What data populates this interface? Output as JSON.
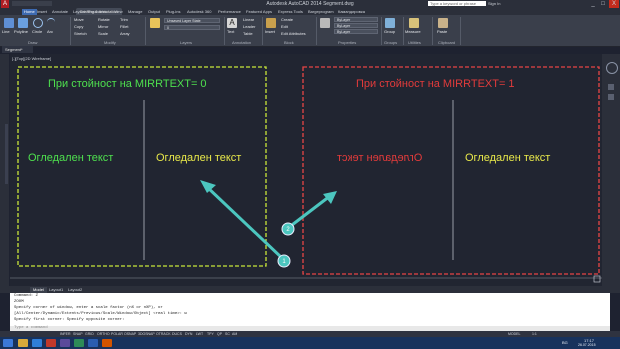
{
  "window": {
    "title": "Autodesk AutoCAD 2014  Segment.dwg",
    "search_placeholder": "Type a keyword or phrase",
    "signin": "Sign In",
    "minimize": "_",
    "maximize": "□",
    "close": "X"
  },
  "ribbon_tabs": {
    "file": "Drafting & Annotation",
    "items": [
      "Home",
      "Insert",
      "Annotate",
      "Layout",
      "Parametric",
      "View",
      "Manage",
      "Output",
      "Plug-ins",
      "Autodesk 360",
      "Performance",
      "Featured Apps",
      "Express Tools",
      "Bargeprogram",
      "Камандировка"
    ]
  },
  "ribbon": {
    "draw": {
      "line": "Line",
      "polyline": "Polyline",
      "circle": "Circle",
      "arc": "Arc",
      "label": "Draw"
    },
    "modify": {
      "move": "Move",
      "rotate": "Rotate",
      "trim": "Trim",
      "copy": "Copy",
      "mirror": "Mirror",
      "fillet": "Fillet",
      "stretch": "Stretch",
      "scale": "Scale",
      "array": "Array",
      "label": "Modify"
    },
    "layers": {
      "layer_state": "Unsaved Layer State",
      "layer_value": "0",
      "label": "Layers"
    },
    "annotation": {
      "text": "Text",
      "linear": "Linear",
      "leader": "Leader",
      "table": "Table",
      "label": "Annotation"
    },
    "block": {
      "insert": "Insert",
      "create": "Create",
      "edit": "Edit",
      "edit_attributes": "Edit Attributes",
      "label": "Block"
    },
    "properties": {
      "color": "ByLayer",
      "linetype": "ByLayer",
      "lineweight": "ByLayer",
      "label": "Properties"
    },
    "groups": {
      "group": "Group",
      "label": "Groups"
    },
    "utilities": {
      "measure": "Measure",
      "label": "Utilities"
    },
    "clipboard": {
      "paste": "Paste",
      "label": "Clipboard"
    }
  },
  "drawing": {
    "doc_tab": "Segment*",
    "viewport_label": "[-][Top][2D Wireframe]",
    "left_box": {
      "heading": "При стойност на MIRRTEXT= 0",
      "text_left": "Огледален текст",
      "text_right": "Огледален текст",
      "color": "#c8e639"
    },
    "right_box": {
      "heading": "При стойност на MIRRTEXT= 1",
      "text_left_mirrored": "Огледален текст",
      "text_right": "Огледален текст",
      "color": "#e64545"
    },
    "callout_1": "1",
    "callout_2": "2",
    "text_green": "#4ee04e",
    "text_yellow": "#e8e84a",
    "text_red": "#e23b3b",
    "arrow_color": "#4cc6bf"
  },
  "layout_tabs": [
    "Model",
    "Layout1",
    "Layout2"
  ],
  "command": {
    "lines": [
      "Command: Z",
      "ZOOM",
      "Specify corner of window, enter a scale factor (nX or nXP), or",
      "[All/Center/Dynamic/Extents/Previous/Scale/Window/Object] <real time>: w",
      "Specify first corner: Specify opposite corner:"
    ],
    "prompt": "Type a command"
  },
  "status": {
    "items": [
      "INFER",
      "SNAP",
      "GRID",
      "ORTHO",
      "POLAR",
      "OSNAP",
      "3DOSNAP",
      "OTRACK",
      "DUCS",
      "DYN",
      "LWT",
      "TPY",
      "QP",
      "SC",
      "AM"
    ],
    "model": "MODEL",
    "scale": "1:1"
  },
  "taskbar": {
    "lang": "BG",
    "time": "17:17",
    "date": "26.07.2015"
  }
}
